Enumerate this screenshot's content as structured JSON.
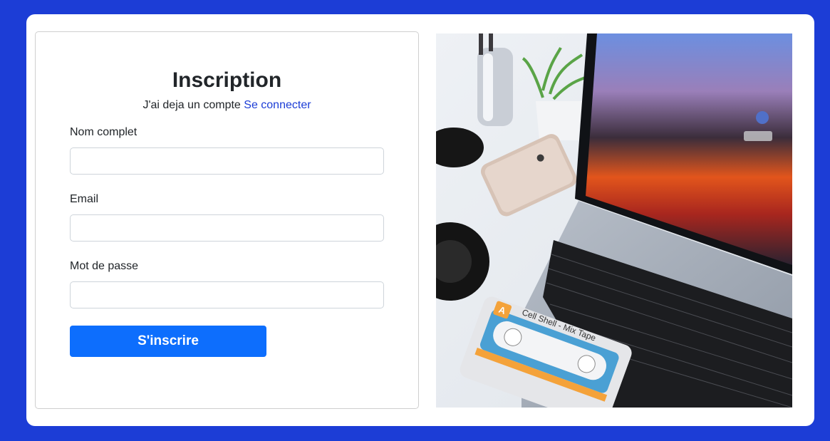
{
  "form": {
    "title": "Inscription",
    "subtitle_text": "J'ai deja un compte",
    "login_link": "Se connecter",
    "fields": [
      {
        "label": "Nom complet",
        "value": ""
      },
      {
        "label": "Email",
        "value": ""
      },
      {
        "label": "Mot de passe",
        "value": ""
      }
    ],
    "submit_label": "S'inscrire"
  },
  "photo": {
    "cassette_text": "Cell Shell - Mix Tape",
    "cassette_badge": "A"
  },
  "colors": {
    "page_background": "#1c3dd6",
    "link": "#1c3dd6",
    "button": "#0d6efd"
  }
}
